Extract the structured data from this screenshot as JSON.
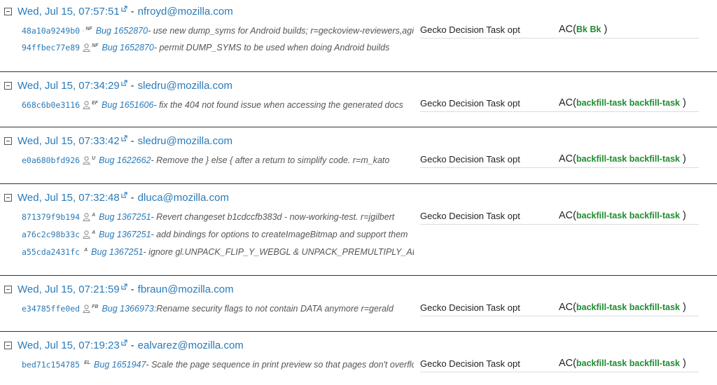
{
  "pushes": [
    {
      "date": "Wed, Jul 15, 07:57:51",
      "author": "nfroyd@mozilla.com",
      "platform": "Gecko Decision Task opt",
      "group_label": "AC",
      "jobs_text": "Bk Bk",
      "revisions": [
        {
          "hash": "48a10a9249b0",
          "initials": "NF",
          "bug": "Bug 1652870",
          "message": " - use new dump_syms for Android builds; r=geckoview-reviewers,agi"
        },
        {
          "hash": "94ffbec77e89",
          "initials": "NF",
          "bug": "Bug 1652870",
          "message": " - permit DUMP_SYMS to be used when doing Android builds"
        }
      ]
    },
    {
      "date": "Wed, Jul 15, 07:34:29",
      "author": "sledru@mozilla.com",
      "platform": "Gecko Decision Task opt",
      "group_label": "AC",
      "jobs_text": "backfill-task backfill-task",
      "revisions": [
        {
          "hash": "668c6b0e3116",
          "initials": "EF",
          "bug": "Bug 1651606",
          "message": " - fix the 404 not found issue when accessing the generated docs"
        }
      ]
    },
    {
      "date": "Wed, Jul 15, 07:33:42",
      "author": "sledru@mozilla.com",
      "platform": "Gecko Decision Task opt",
      "group_label": "AC",
      "jobs_text": "backfill-task backfill-task",
      "revisions": [
        {
          "hash": "e0a680bfd926",
          "initials": "U",
          "bug": "Bug 1622662",
          "message": " - Remove the } else { after a return to simplify code. r=m_kato"
        }
      ]
    },
    {
      "date": "Wed, Jul 15, 07:32:48",
      "author": "dluca@mozilla.com",
      "platform": "Gecko Decision Task opt",
      "group_label": "AC",
      "jobs_text": "backfill-task backfill-task",
      "revisions": [
        {
          "hash": "871379f9b194",
          "initials": "A",
          "bug": "Bug 1367251",
          "message": " - Revert changeset b1cdccfb383d - now-working-test. r=jgilbert"
        },
        {
          "hash": "a76c2c98b33c",
          "initials": "A",
          "bug": "Bug 1367251",
          "message": " - add bindings for options to createImageBitmap and support them"
        },
        {
          "hash": "a55cda2431fc",
          "initials": "A",
          "bug": "Bug 1367251",
          "message": " - ignore gl.UNPACK_FLIP_Y_WEBGL & UNPACK_PREMULTIPLY_ALPHA"
        }
      ]
    },
    {
      "date": "Wed, Jul 15, 07:21:59",
      "author": "fbraun@mozilla.com",
      "platform": "Gecko Decision Task opt",
      "group_label": "AC",
      "jobs_text": "backfill-task backfill-task",
      "revisions": [
        {
          "hash": "e34785ffe0ed",
          "initials": "FB",
          "bug": "Bug 1366973:",
          "message": " Rename security flags to not contain DATA anymore r=gerald"
        }
      ]
    },
    {
      "date": "Wed, Jul 15, 07:19:23",
      "author": "ealvarez@mozilla.com",
      "platform": "Gecko Decision Task opt",
      "group_label": "AC",
      "jobs_text": "backfill-task backfill-task",
      "revisions": [
        {
          "hash": "bed71c154785",
          "initials": "EL",
          "bug": "Bug 1651947",
          "message": " - Scale the page sequence in print preview so that pages don't overflow"
        }
      ]
    }
  ],
  "colors": {
    "link": "#2a7ab8",
    "job_green": "#1e8c2e",
    "border": "#333333"
  },
  "icons": [
    "collapse-minus-icon",
    "external-link-icon",
    "person-icon"
  ]
}
